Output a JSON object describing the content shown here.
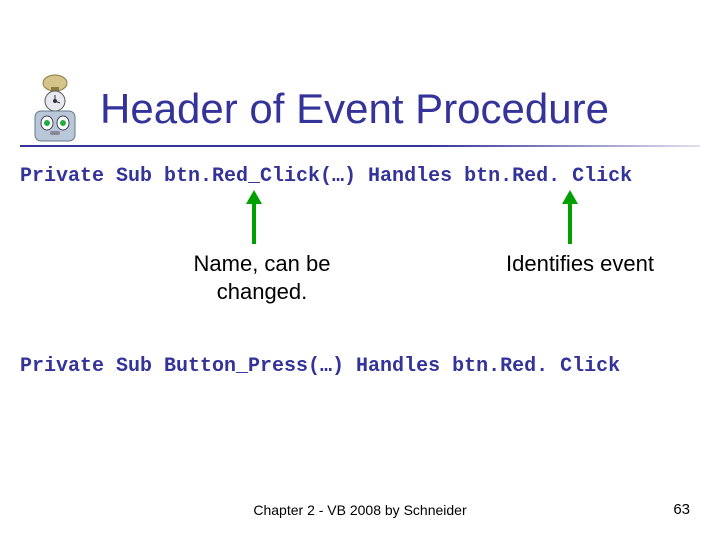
{
  "title": "Header of Event Procedure",
  "code": {
    "line1": "Private Sub btn.Red_Click(…) Handles btn.Red. Click",
    "line2": "Private Sub Button_Press(…) Handles btn.Red. Click"
  },
  "annotations": {
    "name_label": "Name, can be changed.",
    "event_label": "Identifies event"
  },
  "footer": {
    "text": "Chapter 2 - VB 2008 by Schneider",
    "page": "63"
  }
}
